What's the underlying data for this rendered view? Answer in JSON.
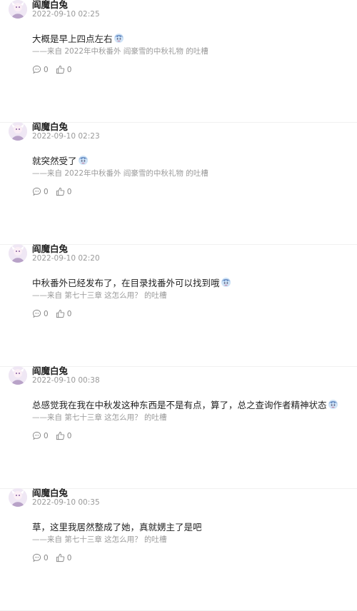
{
  "posts": [
    {
      "username": "阎魔白兔",
      "timestamp": "2022-09-10 02:25",
      "content": "大概是早上四点左右",
      "source": "——来自 2022年中秋番外 阎豪雪的中秋礼物 的吐槽",
      "comment_count": "0",
      "like_count": "0"
    },
    {
      "username": "阎魔白兔",
      "timestamp": "2022-09-10 02:23",
      "content": "就突然受了",
      "source": "——来自 2022年中秋番外 阎豪雪的中秋礼物 的吐槽",
      "comment_count": "0",
      "like_count": "0"
    },
    {
      "username": "阎魔白兔",
      "timestamp": "2022-09-10 02:20",
      "content": "中秋番外已经发布了，在目录找番外可以找到哦",
      "source": "——来自 第七十三章 这怎么用？ 的吐槽",
      "comment_count": "0",
      "like_count": "0"
    },
    {
      "username": "阎魔白兔",
      "timestamp": "2022-09-10 00:38",
      "content": "总感觉我在我在中秋发这种东西是不是有点，算了，总之查询作者精神状态",
      "source": "——来自 第七十三章 这怎么用？ 的吐槽",
      "comment_count": "0",
      "like_count": "0"
    },
    {
      "username": "阎魔白兔",
      "timestamp": "2022-09-10 00:35",
      "content": "草，这里我居然整成了她，真就娚主了是吧",
      "source": "——来自 第七十三章 这怎么用？ 的吐槽",
      "comment_count": "0",
      "like_count": "0"
    }
  ],
  "icons": {
    "comment": "comment-icon",
    "like": "thumbs-up-icon",
    "sticker": "sticker-emoji-icon",
    "avatar": "avatar"
  },
  "colors": {
    "username": "#222222",
    "meta": "#999999",
    "source": "#9a9a9a",
    "avatar_bg": "#efe7f4"
  }
}
